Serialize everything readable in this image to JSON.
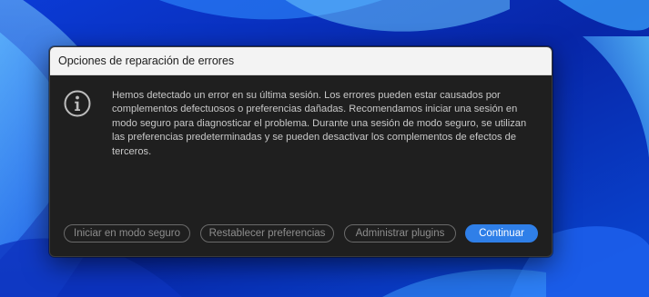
{
  "dialog": {
    "title": "Opciones de reparación de errores",
    "icon": "info-icon",
    "message": "Hemos detectado un error en su última sesión. Los errores pueden estar causados por complementos defectuosos o preferencias dañadas. Recomendamos iniciar una sesión en modo seguro para diagnosticar el problema. Durante una sesión de modo seguro, se utilizan las preferencias predeterminadas y se pueden desactivar los complementos de efectos de terceros.",
    "buttons": {
      "safe_mode": "Iniciar en modo seguro",
      "reset_prefs": "Restablecer preferencias",
      "manage_plugins": "Administrar plugins",
      "continue": "Continuar"
    }
  },
  "colors": {
    "dialog_background": "#1f1f1f",
    "titlebar_background": "#f3f3f3",
    "accent": "#2f7fe8",
    "wallpaper_blue": "#0a2aa8"
  }
}
